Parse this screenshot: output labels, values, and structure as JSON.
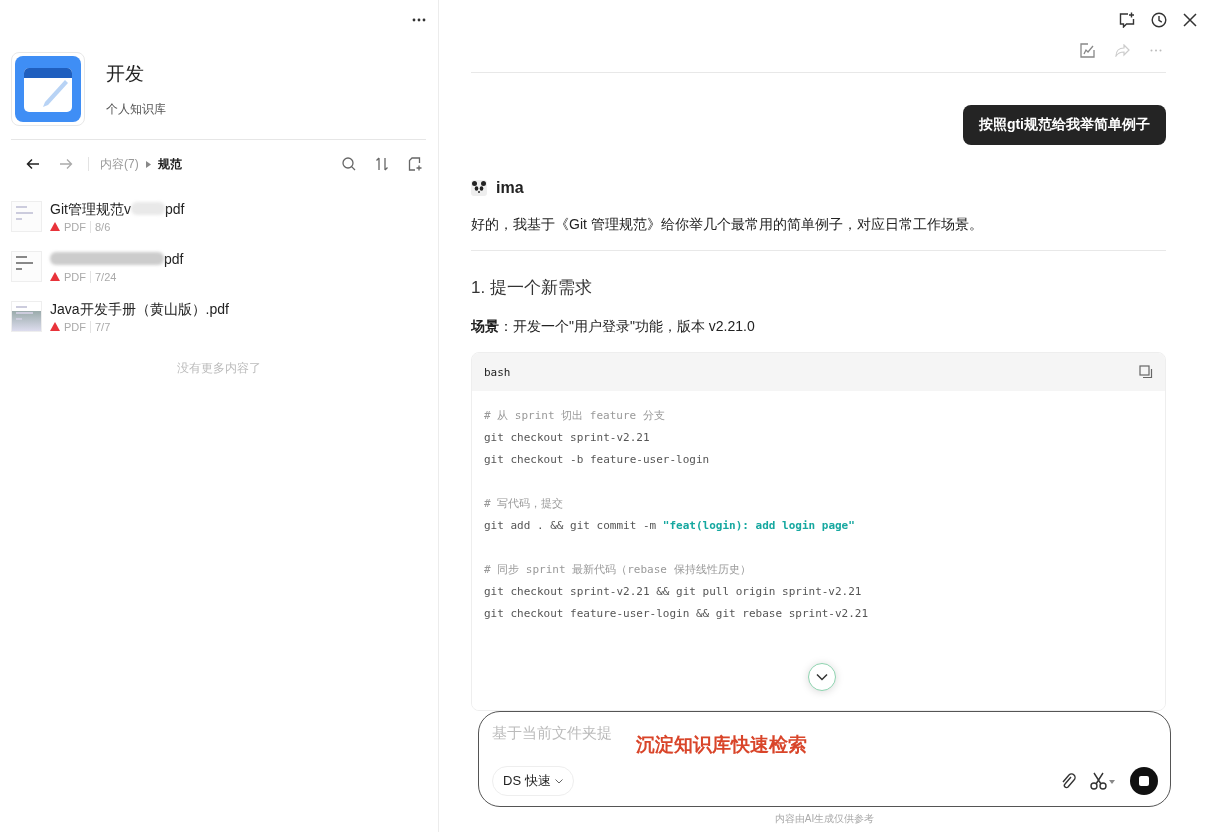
{
  "library": {
    "title": "开发",
    "subtitle": "个人知识库"
  },
  "breadcrumb": {
    "parent": "内容(7)",
    "current": "规范"
  },
  "files": [
    {
      "name_start": "Git管理规范v",
      "redacted": true,
      "name_end": "pdf",
      "type": "PDF",
      "date": "8/6"
    },
    {
      "redacted": true,
      "name_end": "pdf",
      "type": "PDF",
      "date": "7/24"
    },
    {
      "name_end": "Java开发手册（黄山版）.pdf",
      "redacted": false,
      "type": "PDF",
      "date": "7/7"
    }
  ],
  "list_end": "没有更多内容了",
  "chat": {
    "user_message": "按照gti规范给我举简单例子",
    "assistant_name": "ima",
    "intro": "好的，我基于《Git 管理规范》给你举几个最常用的简单例子，对应日常工作场景。",
    "heading": "1. 提一个新需求",
    "scene": "**场景**：开发一个\"用户登录\"功能，版本 v2.21.0",
    "code": {
      "language": "bash",
      "lines": [
        {
          "kind": "comment",
          "text": "# 从 sprint 切出 feature 分支"
        },
        {
          "kind": "code",
          "text": "git checkout sprint-v2.21"
        },
        {
          "kind": "code",
          "text": "git checkout -b feature-user-login"
        },
        {
          "kind": "blank"
        },
        {
          "kind": "comment",
          "text": "# 写代码，提交"
        },
        {
          "kind": "code",
          "text": "git add . && git commit -m ",
          "string": "\"feat(login): add login page\""
        },
        {
          "kind": "blank"
        },
        {
          "kind": "comment",
          "text": "# 同步 sprint 最新代码（rebase 保持线性历史）"
        },
        {
          "kind": "code",
          "text": "git checkout sprint-v2.21 && git pull origin sprint-v2.21"
        },
        {
          "kind": "code",
          "text": "git checkout feature-user-login && git rebase sprint-v2.21"
        }
      ]
    }
  },
  "composer": {
    "placeholder": "基于当前文件夹提",
    "model": "DS 快速",
    "annotation": "沉淀知识库快速检索",
    "disclaimer": "内容由AI生成仅供参考"
  }
}
